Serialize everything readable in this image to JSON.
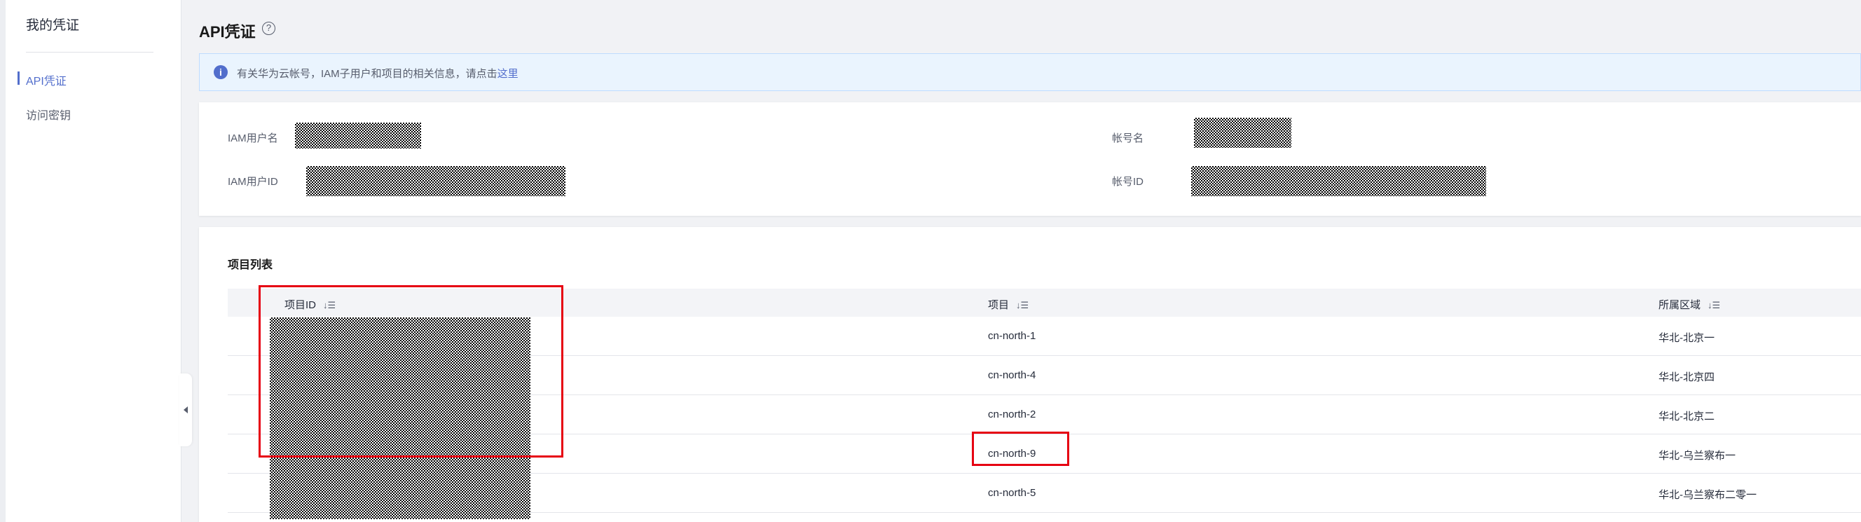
{
  "sidebar": {
    "title": "我的凭证",
    "items": [
      {
        "label": "API凭证",
        "active": true
      },
      {
        "label": "访问密钥",
        "active": false
      }
    ]
  },
  "page": {
    "title": "API凭证",
    "help_icon": "?"
  },
  "banner": {
    "icon": "i",
    "text": "有关华为云帐号，IAM子用户和项目的相关信息，请点击",
    "link_text": "这里"
  },
  "account_info": {
    "iam_username_label": "IAM用户名",
    "iam_user_id_label": "IAM用户ID",
    "account_name_label": "帐号名",
    "account_id_label": "帐号ID"
  },
  "projects": {
    "section_title": "项目列表",
    "columns": [
      "项目ID",
      "项目",
      "所属区域"
    ],
    "sort_icon": "↓☰",
    "rows": [
      {
        "project": "cn-north-1",
        "region": "华北-北京一"
      },
      {
        "project": "cn-north-4",
        "region": "华北-北京四"
      },
      {
        "project": "cn-north-2",
        "region": "华北-北京二"
      },
      {
        "project": "cn-north-9",
        "region": "华北-乌兰察布一"
      },
      {
        "project": "cn-north-5",
        "region": "华北-乌兰察布二零一"
      }
    ]
  },
  "colors": {
    "accent": "#526ecc",
    "highlight": "#e60012"
  }
}
